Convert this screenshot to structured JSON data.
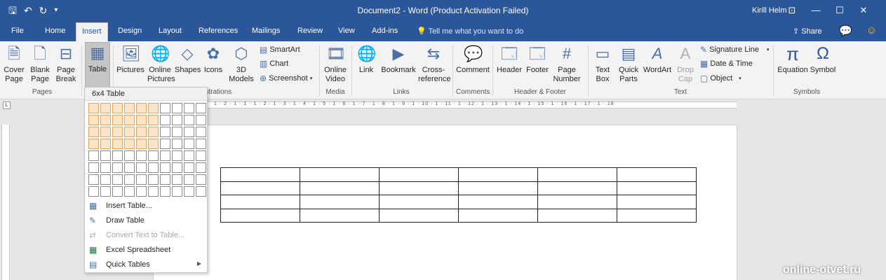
{
  "titlebar": {
    "title": "Document2 - Word (Product Activation Failed)",
    "user": "Kirill Helm",
    "qat": [
      "save-icon",
      "undo-icon",
      "redo-icon",
      "customize-icon"
    ]
  },
  "tabs": [
    "File",
    "Home",
    "Insert",
    "Design",
    "Layout",
    "References",
    "Mailings",
    "Review",
    "View",
    "Add-ins"
  ],
  "tellme": "Tell me what you want to do",
  "share": "Share",
  "ribbon": {
    "pages": {
      "label": "Pages",
      "cover": "Cover\nPage",
      "blank": "Blank\nPage",
      "break": "Page\nBreak"
    },
    "tables": {
      "table": "Table"
    },
    "illustrations": {
      "label": "Illustrations",
      "pictures": "Pictures",
      "online_pictures": "Online\nPictures",
      "shapes": "Shapes",
      "icons": "Icons",
      "models": "3D\nModels",
      "smartart": "SmartArt",
      "chart": "Chart",
      "screenshot": "Screenshot"
    },
    "media": {
      "label": "Media",
      "online_video": "Online\nVideo"
    },
    "links": {
      "label": "Links",
      "link": "Link",
      "bookmark": "Bookmark",
      "crossref": "Cross-\nreference"
    },
    "comments": {
      "label": "Comments",
      "comment": "Comment"
    },
    "headerfooter": {
      "label": "Header & Footer",
      "header": "Header",
      "footer": "Footer",
      "pagenumber": "Page\nNumber"
    },
    "text": {
      "label": "Text",
      "textbox": "Text\nBox",
      "quickparts": "Quick\nParts",
      "wordart": "WordArt",
      "dropcap": "Drop\nCap",
      "signature": "Signature Line",
      "datetime": "Date & Time",
      "object": "Object"
    },
    "symbols": {
      "label": "Symbols",
      "equation": "Equation",
      "symbol": "Symbol"
    }
  },
  "ruler_text": "1 · 2 · 1 · 1 · 1 · 2 · 1 · 3 · 1 · 4 · 1 · 5 · 1 · 6 · 1 · 7 · 1 · 8 · 1 · 9 · 1 · 10 · 1 · 11 · 1 · 12 · 1 · 13 · 1 · 14 · 1 · 15 · 1 · 16 · 1 · 17 · 1 · 18",
  "dropdown": {
    "header": "6x4 Table",
    "grid_cols": 10,
    "grid_rows": 8,
    "selected_cols": 6,
    "selected_rows": 4,
    "items": [
      {
        "label": "Insert Table...",
        "icon": "table-icon",
        "disabled": false
      },
      {
        "label": "Draw Table",
        "icon": "pencil-icon",
        "disabled": false
      },
      {
        "label": "Convert Text to Table...",
        "icon": "convert-icon",
        "disabled": true
      },
      {
        "label": "Excel Spreadsheet",
        "icon": "excel-icon",
        "disabled": false
      },
      {
        "label": "Quick Tables",
        "icon": "quick-tables-icon",
        "disabled": false,
        "submenu": true
      }
    ]
  },
  "document_table": {
    "rows": 4,
    "cols": 6
  },
  "watermark": "online-otvet.ru"
}
